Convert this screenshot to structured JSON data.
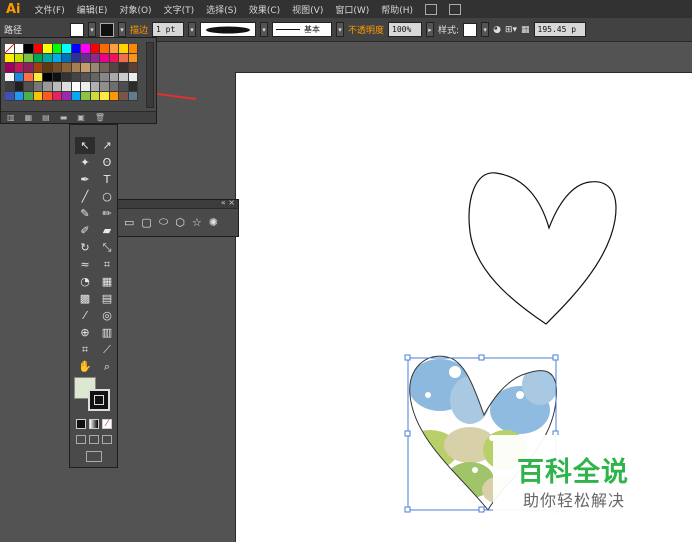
{
  "app": {
    "logo": "Ai"
  },
  "menu": [
    {
      "label": "文件(F)"
    },
    {
      "label": "编辑(E)"
    },
    {
      "label": "对象(O)"
    },
    {
      "label": "文字(T)"
    },
    {
      "label": "选择(S)"
    },
    {
      "label": "效果(C)"
    },
    {
      "label": "视图(V)"
    },
    {
      "label": "窗口(W)"
    },
    {
      "label": "帮助(H)"
    }
  ],
  "options": {
    "object_type": "路径",
    "stroke_label": "描边",
    "stroke_weight": "1 pt",
    "profile_label": "基本",
    "opacity_label": "不透明度",
    "opacity_value": "100%",
    "style_label": "样式:",
    "width_value": "195.45 p"
  },
  "swatches": {
    "colors": [
      "#ffffff",
      "#ffffff",
      "#000000",
      "#ff0000",
      "#ffff00",
      "#00ff00",
      "#00ffff",
      "#0000ff",
      "#ff00ff",
      "#ff0000",
      "#ff6a00",
      "#ff9e3d",
      "#ffd200",
      "#ff8800",
      "#ffee00",
      "#c8e000",
      "#7bc142",
      "#00a651",
      "#00a99d",
      "#00aeef",
      "#0072bc",
      "#2e3192",
      "#662d91",
      "#92278f",
      "#ec008c",
      "#ed145b",
      "#f26c4f",
      "#f7941d",
      "#9e005d",
      "#c2185b",
      "#8e1f5d",
      "#a0410d",
      "#603913",
      "#754c24",
      "#8c6239",
      "#a67c52",
      "#c69c6d",
      "#998675",
      "#736357",
      "#534741",
      "#362f2d",
      "#5c4033",
      "#f5f5f5",
      "#1e88e5",
      "#ff7043",
      "#ffeb3b",
      "#000000",
      "#111111",
      "#333333",
      "#444444",
      "#555555",
      "#666666",
      "#888888",
      "#aaaaaa",
      "#cccccc",
      "#eeeeee",
      "#3e3e3e",
      "#202020",
      "#505050",
      "#777777",
      "#999999",
      "#bbbbbb",
      "#dddddd",
      "#ffffff",
      "#ededed",
      "#b0b0b0",
      "#8f8f8f",
      "#6e6e6e",
      "#4d4d4d",
      "#2c2c2c",
      "#3f51b5",
      "#2196f3",
      "#4caf50",
      "#ffc107",
      "#ff5722",
      "#e91e63",
      "#9c27b0",
      "#03a9f4",
      "#8bc34a",
      "#cddc39",
      "#ffeb3b",
      "#ff9800",
      "#795548",
      "#607d8b"
    ]
  },
  "tools": [
    {
      "name": "selection-tool",
      "glyph": "↖"
    },
    {
      "name": "direct-selection-tool",
      "glyph": "↗"
    },
    {
      "name": "magic-wand-tool",
      "glyph": "✦"
    },
    {
      "name": "lasso-tool",
      "glyph": "ʘ"
    },
    {
      "name": "pen-tool",
      "glyph": "✒"
    },
    {
      "name": "type-tool",
      "glyph": "T"
    },
    {
      "name": "line-tool",
      "glyph": "╱"
    },
    {
      "name": "ellipse-tool",
      "glyph": "○"
    },
    {
      "name": "paintbrush-tool",
      "glyph": "✎"
    },
    {
      "name": "pencil-tool",
      "glyph": "✏"
    },
    {
      "name": "blob-brush-tool",
      "glyph": "✐"
    },
    {
      "name": "eraser-tool",
      "glyph": "▰"
    },
    {
      "name": "rotate-tool",
      "glyph": "↻"
    },
    {
      "name": "scale-tool",
      "glyph": "⤡"
    },
    {
      "name": "warp-tool",
      "glyph": "≈"
    },
    {
      "name": "free-transform-tool",
      "glyph": "⌗"
    },
    {
      "name": "shape-builder-tool",
      "glyph": "◔"
    },
    {
      "name": "perspective-grid-tool",
      "glyph": "▦"
    },
    {
      "name": "mesh-tool",
      "glyph": "▩"
    },
    {
      "name": "gradient-tool",
      "glyph": "▤"
    },
    {
      "name": "eyedropper-tool",
      "glyph": "⁄"
    },
    {
      "name": "blend-tool",
      "glyph": "◎"
    },
    {
      "name": "symbol-sprayer-tool",
      "glyph": "⊕"
    },
    {
      "name": "column-graph-tool",
      "glyph": "▥"
    },
    {
      "name": "artboard-tool",
      "glyph": "⌗"
    },
    {
      "name": "slice-tool",
      "glyph": "⟋"
    },
    {
      "name": "hand-tool",
      "glyph": "✋"
    },
    {
      "name": "zoom-tool",
      "glyph": "⌕"
    }
  ],
  "watermark": {
    "title": "百科全说",
    "subtitle": "助你轻松解决"
  },
  "colors": {
    "menubar": "#323232",
    "panel": "#4a4a4a",
    "workspace": "#535353",
    "selection": "#4a7fd9",
    "arrow": "#e03030"
  }
}
